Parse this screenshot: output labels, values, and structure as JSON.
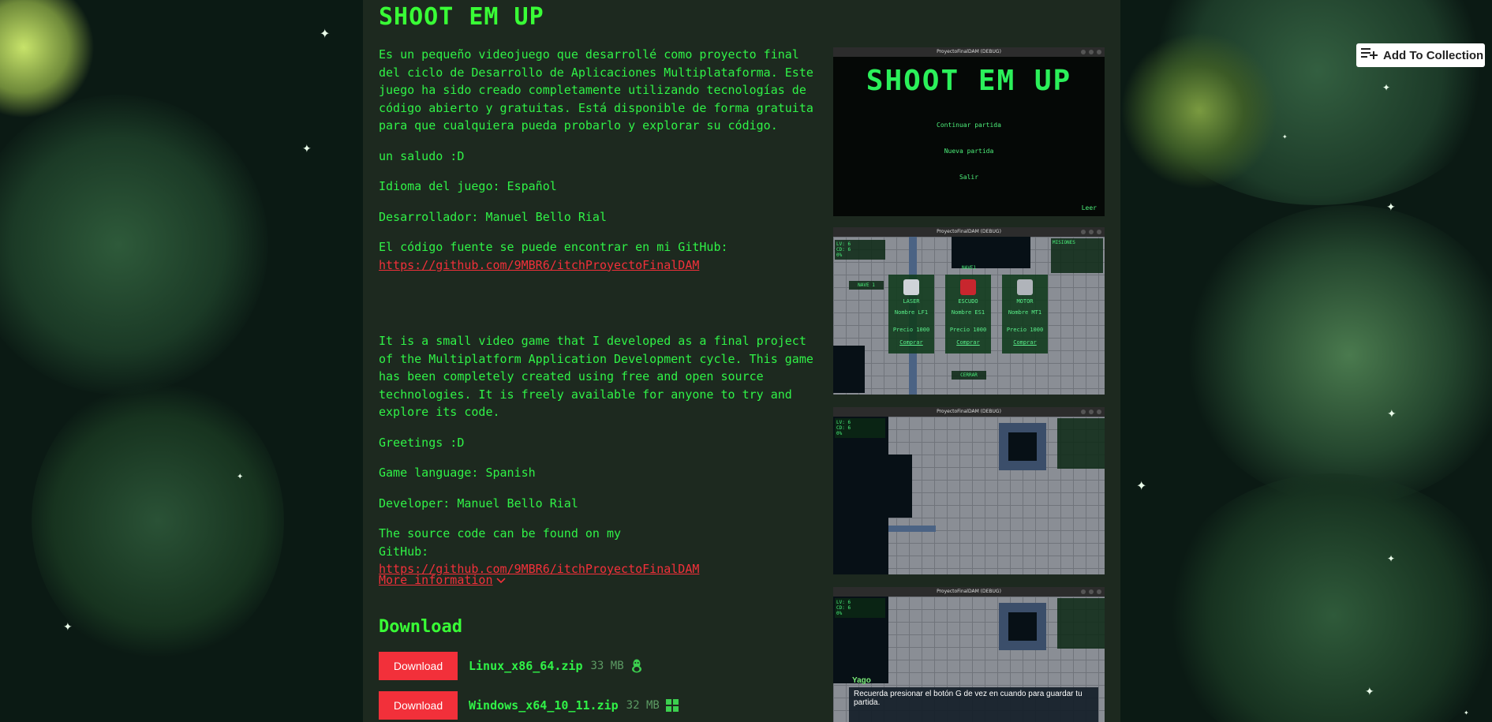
{
  "game": {
    "title": "SHOOT EM UP",
    "description_es": [
      "Es un pequeño videojuego que desarrollé como proyecto final del ciclo de Desarrollo de Aplicaciones Multiplataforma. Este juego ha sido creado completamente utilizando tecnologías de código abierto y gratuitas. Está disponible de forma gratuita para que cualquiera pueda probarlo y explorar su código.",
      "un saludo :D",
      "Idioma del juego: Español",
      "Desarrollador: Manuel Bello Rial"
    ],
    "source_es": "El código fuente se puede encontrar en mi GitHub:",
    "github_url": "https://github.com/9MBR6/itchProyectoFinalDAM",
    "description_en": [
      "It is a small video game that I developed as a final project of the Multiplatform Application Development cycle. This game has been completely created using free and open source technologies. It is freely available for anyone to try and explore its code.",
      "Greetings :D",
      "Game language: Spanish",
      "Developer: Manuel Bello Rial"
    ],
    "source_en": "The source code can be found on my GitHub:",
    "more_info": "More information"
  },
  "download": {
    "heading": "Download",
    "button_label": "Download",
    "files": [
      {
        "name": "Linux_x86_64.zip",
        "size": "33 MB",
        "os_icon": "linux-icon"
      },
      {
        "name": "Windows_x64_10_11.zip",
        "size": "32 MB",
        "os_icon": "windows-icon"
      }
    ]
  },
  "screenshots": {
    "window_title": "ProyectoFinalDAM (DEBUG)",
    "title_screen": {
      "logo": "SHOOT EM UP",
      "menu": [
        "Continuar partida",
        "Nueva partida",
        "Salir"
      ],
      "corner": "Leer"
    },
    "hud": {
      "lv": "LV: 6",
      "cd": "CD: 6",
      "pct": "0%"
    },
    "shop": {
      "header": "NAVE1",
      "missions": "MISIONES",
      "left_label": "NAVE 1",
      "items": [
        {
          "name": "LASER",
          "id": "Nombre LF1",
          "price": "Precio 1000",
          "buy": "Comprar"
        },
        {
          "name": "ESCUDO",
          "id": "Nombre ES1",
          "price": "Precio 1000",
          "buy": "Comprar"
        },
        {
          "name": "MOTOR",
          "id": "Nombre MT1",
          "price": "Precio 1000",
          "buy": "Comprar"
        }
      ],
      "close": "CERRAR"
    },
    "dialog": {
      "speaker": "Yago",
      "text": "Recuerda presionar el botón G de vez en cuando para guardar tu partida."
    }
  },
  "collection": {
    "label": "Add To Collection"
  },
  "colors": {
    "accent": "#39ff36",
    "link": "#f2303a",
    "page_bg": "#1d291f"
  }
}
